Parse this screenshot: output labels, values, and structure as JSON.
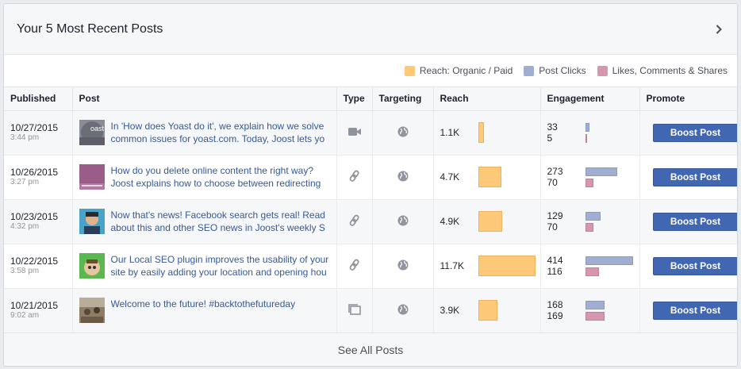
{
  "header": {
    "title": "Your 5 Most Recent Posts"
  },
  "legend": [
    {
      "label": "Reach: Organic / Paid",
      "color": "#fdc979"
    },
    {
      "label": "Post Clicks",
      "color": "#a0aed1"
    },
    {
      "label": "Likes, Comments & Shares",
      "color": "#d697ae"
    }
  ],
  "columns": [
    "Published",
    "Post",
    "Type",
    "Targeting",
    "Reach",
    "Engagement",
    "Promote"
  ],
  "rows": [
    {
      "date": "10/27/2015",
      "time": "3:44 pm",
      "text": "In 'How does Yoast do it', we explain how we solve common issues for yoast.com. Today, Joost lets yo",
      "type_icon": "video-icon",
      "reach": "1.1K",
      "reach_value": 1100,
      "clicks": "33",
      "likes": "5",
      "clicks_value": 33,
      "likes_value": 5,
      "thumb": "yoast-logo-thumb",
      "boost": "Boost Post"
    },
    {
      "date": "10/26/2015",
      "time": "3:27 pm",
      "text": "How do you delete online content the right way? Joost explains how to choose between redirecting or",
      "type_icon": "link-icon",
      "reach": "4.7K",
      "reach_value": 4700,
      "clicks": "273",
      "likes": "70",
      "clicks_value": 273,
      "likes_value": 70,
      "thumb": "purple-thumb",
      "boost": "Boost Post"
    },
    {
      "date": "10/23/2015",
      "time": "4:32 pm",
      "text": "Now that's news! Facebook search gets real! Read about this and other SEO news in Joost's weekly S",
      "type_icon": "link-icon",
      "reach": "4.9K",
      "reach_value": 4900,
      "clicks": "129",
      "likes": "70",
      "clicks_value": 129,
      "likes_value": 70,
      "thumb": "person-thumb",
      "boost": "Boost Post"
    },
    {
      "date": "10/22/2015",
      "time": "3:58 pm",
      "text": "Our Local SEO plugin improves the usability of your site by easily adding your location and opening hou",
      "type_icon": "link-icon",
      "reach": "11.7K",
      "reach_value": 11700,
      "clicks": "414",
      "likes": "116",
      "clicks_value": 414,
      "likes_value": 116,
      "thumb": "green-thumb",
      "boost": "Boost Post"
    },
    {
      "date": "10/21/2015",
      "time": "9:02 am",
      "text": "Welcome to the future! #backtothefutureday",
      "type_icon": "album-icon",
      "reach": "3.9K",
      "reach_value": 3900,
      "clicks": "168",
      "likes": "169",
      "clicks_value": 168,
      "likes_value": 169,
      "thumb": "room-thumb",
      "boost": "Boost Post"
    }
  ],
  "footer": {
    "label": "See All Posts"
  }
}
